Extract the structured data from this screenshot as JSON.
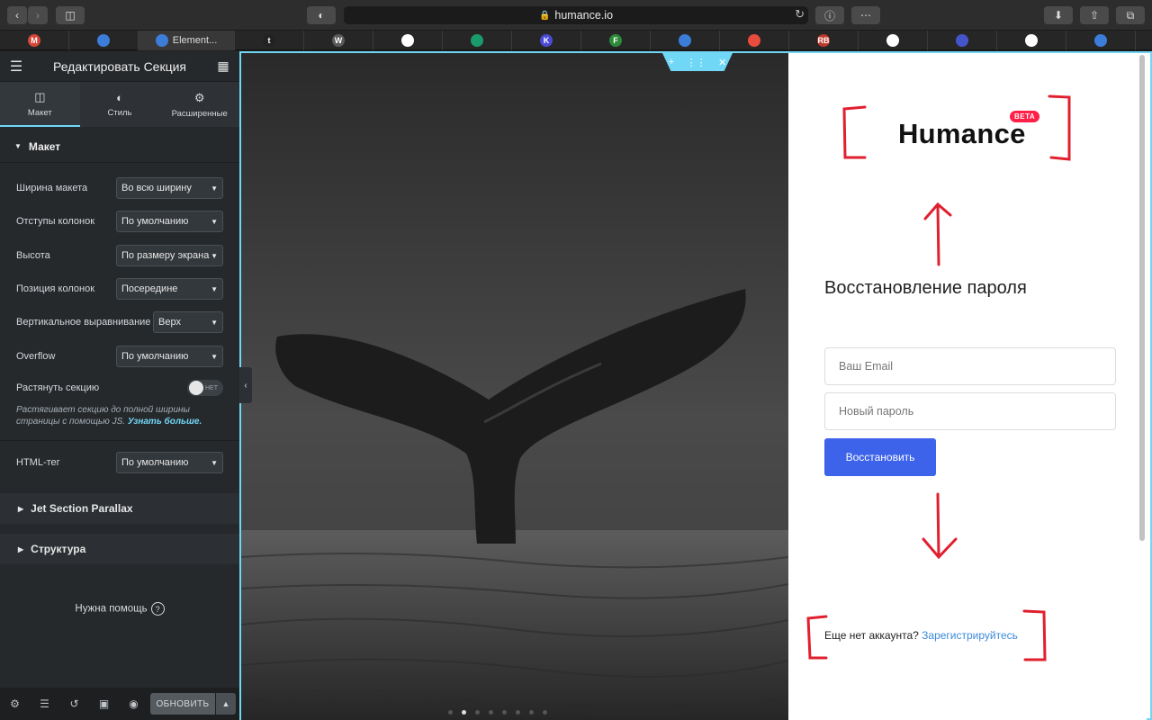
{
  "browser": {
    "url": "humance.io",
    "active_tab": "Element...",
    "bookmarks": [
      "M",
      "",
      "Element...",
      "t",
      "W",
      "G",
      "",
      "K",
      "F",
      "",
      "",
      "RB",
      "",
      "",
      "",
      ""
    ],
    "bookmark_colors": [
      "#d44638",
      "#3c7dd9",
      "#3c7dd9",
      "#222222",
      "#5a5a5a",
      "#ffffff",
      "#1a9b6c",
      "#4b4ad7",
      "#2c8a3a",
      "#3c7dd9",
      "#e84c3d",
      "#c0392b",
      "#ffffff",
      "#4455cc",
      "#ffffff",
      "#3c7dd9"
    ]
  },
  "panel": {
    "title": "Редактировать Секция",
    "tabs": [
      {
        "label": "Макет",
        "icon": "layout-icon"
      },
      {
        "label": "Стиль",
        "icon": "contrast-icon"
      },
      {
        "label": "Расширенные",
        "icon": "gear-icon"
      }
    ],
    "section": "Макет",
    "controls": [
      {
        "label": "Ширина макета",
        "value": "Во всю ширину"
      },
      {
        "label": "Отступы колонок",
        "value": "По умолчанию"
      },
      {
        "label": "Высота",
        "value": "По размеру экрана"
      },
      {
        "label": "Позиция колонок",
        "value": "Посередине"
      },
      {
        "label": "Вертикальное выравнивание",
        "value": "Верх"
      },
      {
        "label": "Overflow",
        "value": "По умолчанию"
      }
    ],
    "stretch": {
      "label": "Растянуть секцию",
      "toggle": "НЕТ",
      "on": false
    },
    "hint": "Растягивает секцию до полной ширины страницы с помощью JS.",
    "hint_link": "Узнать больше.",
    "html_tag": {
      "label": "HTML-тег",
      "value": "По умолчанию"
    },
    "collapsed": [
      "Jet Section Parallax",
      "Структура"
    ],
    "help": "Нужна помощь",
    "update_button": "ОБНОВИТЬ"
  },
  "page": {
    "logo": "Humance",
    "badge": "BETA",
    "heading": "Восстановление пароля",
    "email_placeholder": "Ваш Email",
    "password_placeholder": "Новый пароль",
    "submit": "Восстановить",
    "signup_text": "Еще нет аккаунта?",
    "signup_link": "Зарегистрируйтесь",
    "accent": "#3d63ea",
    "annotation_color": "#e0202e",
    "slider_active_dot": 2
  }
}
